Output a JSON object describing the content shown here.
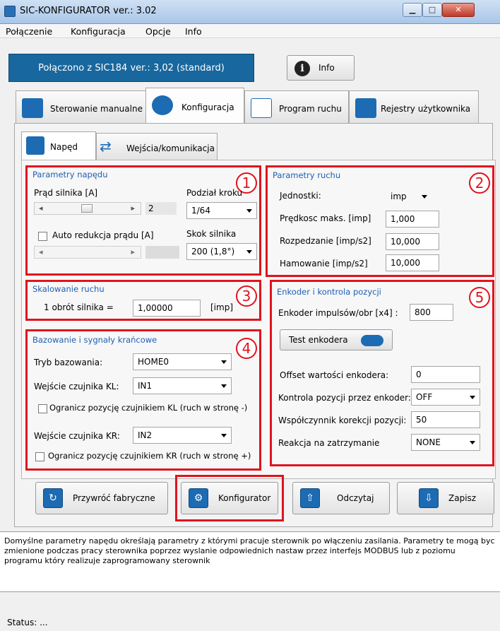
{
  "window": {
    "title": "SIC-KONFIGURATOR  ver.: 3.02"
  },
  "menu": [
    "Połączenie",
    "Konfiguracja",
    "Opcje",
    "Info"
  ],
  "connection": {
    "status": "Połączono z SIC184 ver.: 3,02  (standard)",
    "info_button": "Info"
  },
  "tabs": [
    "Sterowanie manualne",
    "Konfiguracja",
    "Program ruchu",
    "Rejestry użytkownika"
  ],
  "subtabs": [
    "Napęd",
    "Wejścia/komunikacja"
  ],
  "group1": {
    "number": "1",
    "title": "Parametry napędu",
    "current_label": "Prąd silnika [A]",
    "current_value": "2",
    "microstep_label": "Podział kroku",
    "microstep_value": "1/64",
    "auto_reduce_label": "Auto redukcja prądu [A]",
    "auto_reduce_checked": false,
    "step_label": "Skok silnika",
    "step_value": "200  (1,8°)"
  },
  "group2": {
    "number": "2",
    "title": "Parametry ruchu",
    "units_label": "Jednostki:",
    "units_value": "imp",
    "vmax_label": "Prędkosc maks. [imp]",
    "vmax_value": "1,000",
    "accel_label": "Rozpedzanie [imp/s2]",
    "accel_value": "10,000",
    "decel_label": "Hamowanie [imp/s2]",
    "decel_value": "10,000"
  },
  "group3": {
    "number": "3",
    "title": "Skalowanie ruchu",
    "rev_label": "1 obrót silnika =",
    "rev_value": "1,00000",
    "rev_unit": "[imp]"
  },
  "group4": {
    "number": "4",
    "title": "Bazowanie i sygnały krańcowe",
    "homing_label": "Tryb bazowania:",
    "homing_value": "HOME0",
    "kl_label": "Wejście czujnika KL:",
    "kl_value": "IN1",
    "kl_limit_label": "Ogranicz pozycję czujnikiem KL (ruch w stronę -)",
    "kr_label": "Wejście czujnika KR:",
    "kr_value": "IN2",
    "kr_limit_label": "Ogranicz pozycję czujnikiem KR  (ruch w stronę +)"
  },
  "group5": {
    "number": "5",
    "title": "Enkoder i kontrola pozycji",
    "pulses_label": "Enkoder impulsów/obr [x4] :",
    "pulses_value": "800",
    "test_button": "Test enkodera",
    "offset_label": "Offset wartości enkodera:",
    "offset_value": "0",
    "control_label": "Kontrola pozycji przez enkoder:",
    "control_value": "OFF",
    "coef_label": "Współczynnik korekcji pozycji:",
    "coef_value": "50",
    "reaction_label": "Reakcja na zatrzymanie",
    "reaction_value": "NONE"
  },
  "buttons": {
    "factory": "Przywróć fabryczne",
    "configurator": "Konfigurator",
    "read": "Odczytaj",
    "save": "Zapisz"
  },
  "description": "Domyślne parametry napędu określają parametry z którymi pracuje sterownik po włączeniu zasilania. Parametry te mogą byc zmienione podczas pracy sterownika poprzez wyslanie odpowiednich nastaw przez interfejs MODBUS lub z poziomu programu który realizuje zaprogramowany sterownik",
  "status": "Status: ...",
  "colors": {
    "accent": "#18679e",
    "highlight": "#e0141e",
    "group_title": "#1e5fb4"
  }
}
